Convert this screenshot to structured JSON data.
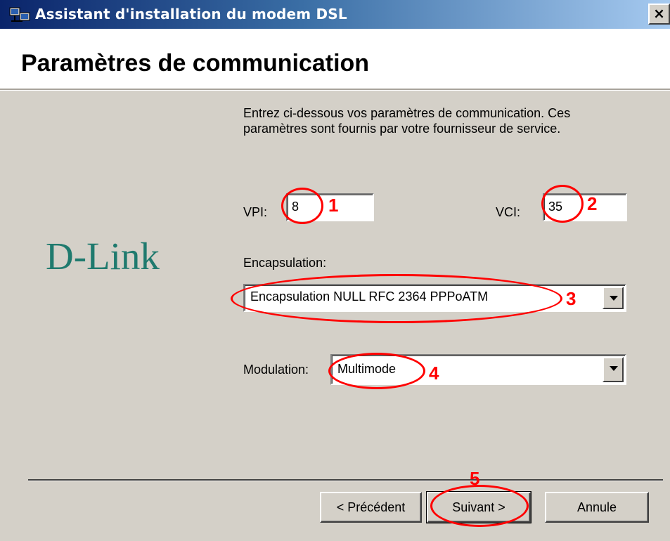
{
  "window": {
    "title": "Assistant d'installation du modem DSL",
    "close_label": "×"
  },
  "header": {
    "title": "Paramètres de communication"
  },
  "logo": {
    "text": "D-Link"
  },
  "form": {
    "instructions": "Entrez ci-dessous vos paramètres de communication. Ces paramètres sont fournis par votre fournisseur de service.",
    "vpi": {
      "label": "VPI:",
      "value": "8"
    },
    "vci": {
      "label": "VCI:",
      "value": "35"
    },
    "encapsulation": {
      "label": "Encapsulation:",
      "value": "Encapsulation NULL RFC 2364 PPPoATM"
    },
    "modulation": {
      "label": "Modulation:",
      "value": "Multimode"
    }
  },
  "buttons": {
    "back": "< Précédent",
    "next": "Suivant >",
    "cancel": "Annule"
  },
  "annotations": {
    "color": "#ff0000",
    "items": [
      "1",
      "2",
      "3",
      "4",
      "5"
    ]
  }
}
